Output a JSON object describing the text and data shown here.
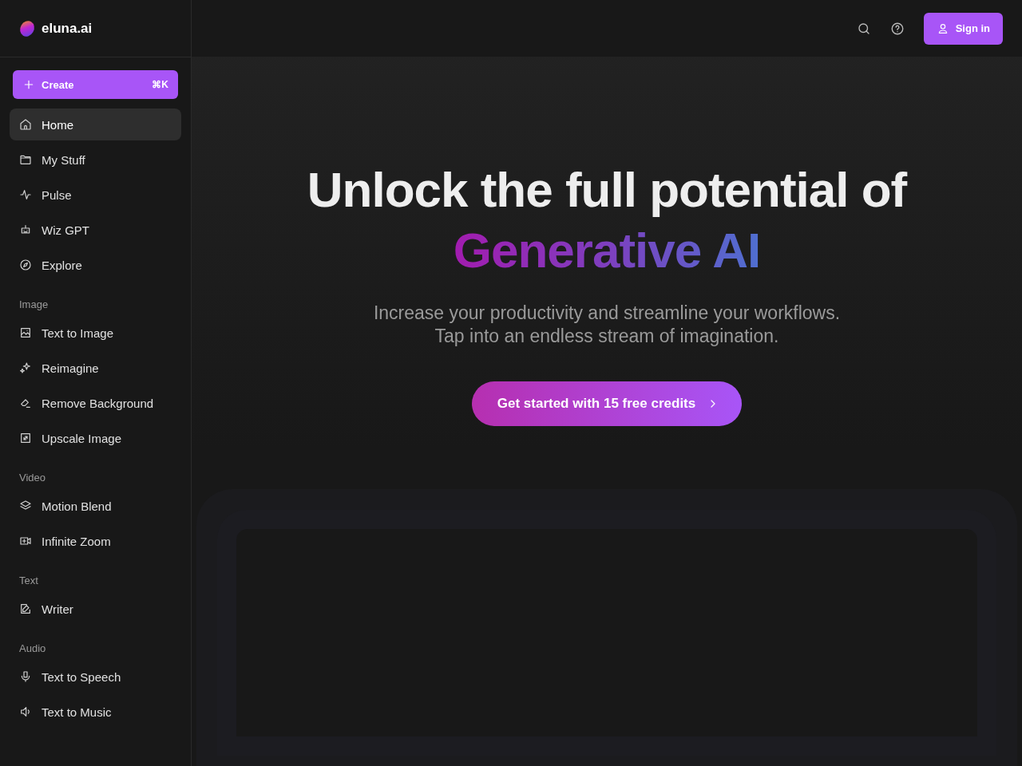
{
  "brand": {
    "name": "eluna.ai"
  },
  "create_button": {
    "label": "Create",
    "shortcut": "⌘K"
  },
  "sidebar": {
    "sections": [
      {
        "items": [
          {
            "label": "Home",
            "selected": true
          },
          {
            "label": "My Stuff",
            "selected": false
          },
          {
            "label": "Pulse",
            "selected": false
          },
          {
            "label": "Wiz GPT",
            "selected": false
          },
          {
            "label": "Explore",
            "selected": false
          }
        ]
      },
      {
        "title": "Image",
        "items": [
          {
            "label": "Text to Image",
            "selected": false
          },
          {
            "label": "Reimagine",
            "selected": false
          },
          {
            "label": "Remove Background",
            "selected": false
          },
          {
            "label": "Upscale Image",
            "selected": false
          }
        ]
      },
      {
        "title": "Video",
        "items": [
          {
            "label": "Motion Blend",
            "selected": false
          },
          {
            "label": "Infinite Zoom",
            "selected": false
          }
        ]
      },
      {
        "title": "Text",
        "items": [
          {
            "label": "Writer",
            "selected": false
          }
        ]
      },
      {
        "title": "Audio",
        "items": [
          {
            "label": "Text to Speech",
            "selected": false
          },
          {
            "label": "Text to Music",
            "selected": false
          }
        ]
      }
    ]
  },
  "header": {
    "sign_in": "Sign in"
  },
  "hero": {
    "title": "Unlock the full potential of",
    "highlight": "Generative AI",
    "subtitle_lines": [
      "Increase your productivity and streamline your workflows.",
      "Tap into an endless stream of imagination."
    ],
    "cta": "Get started with 15 free credits"
  }
}
